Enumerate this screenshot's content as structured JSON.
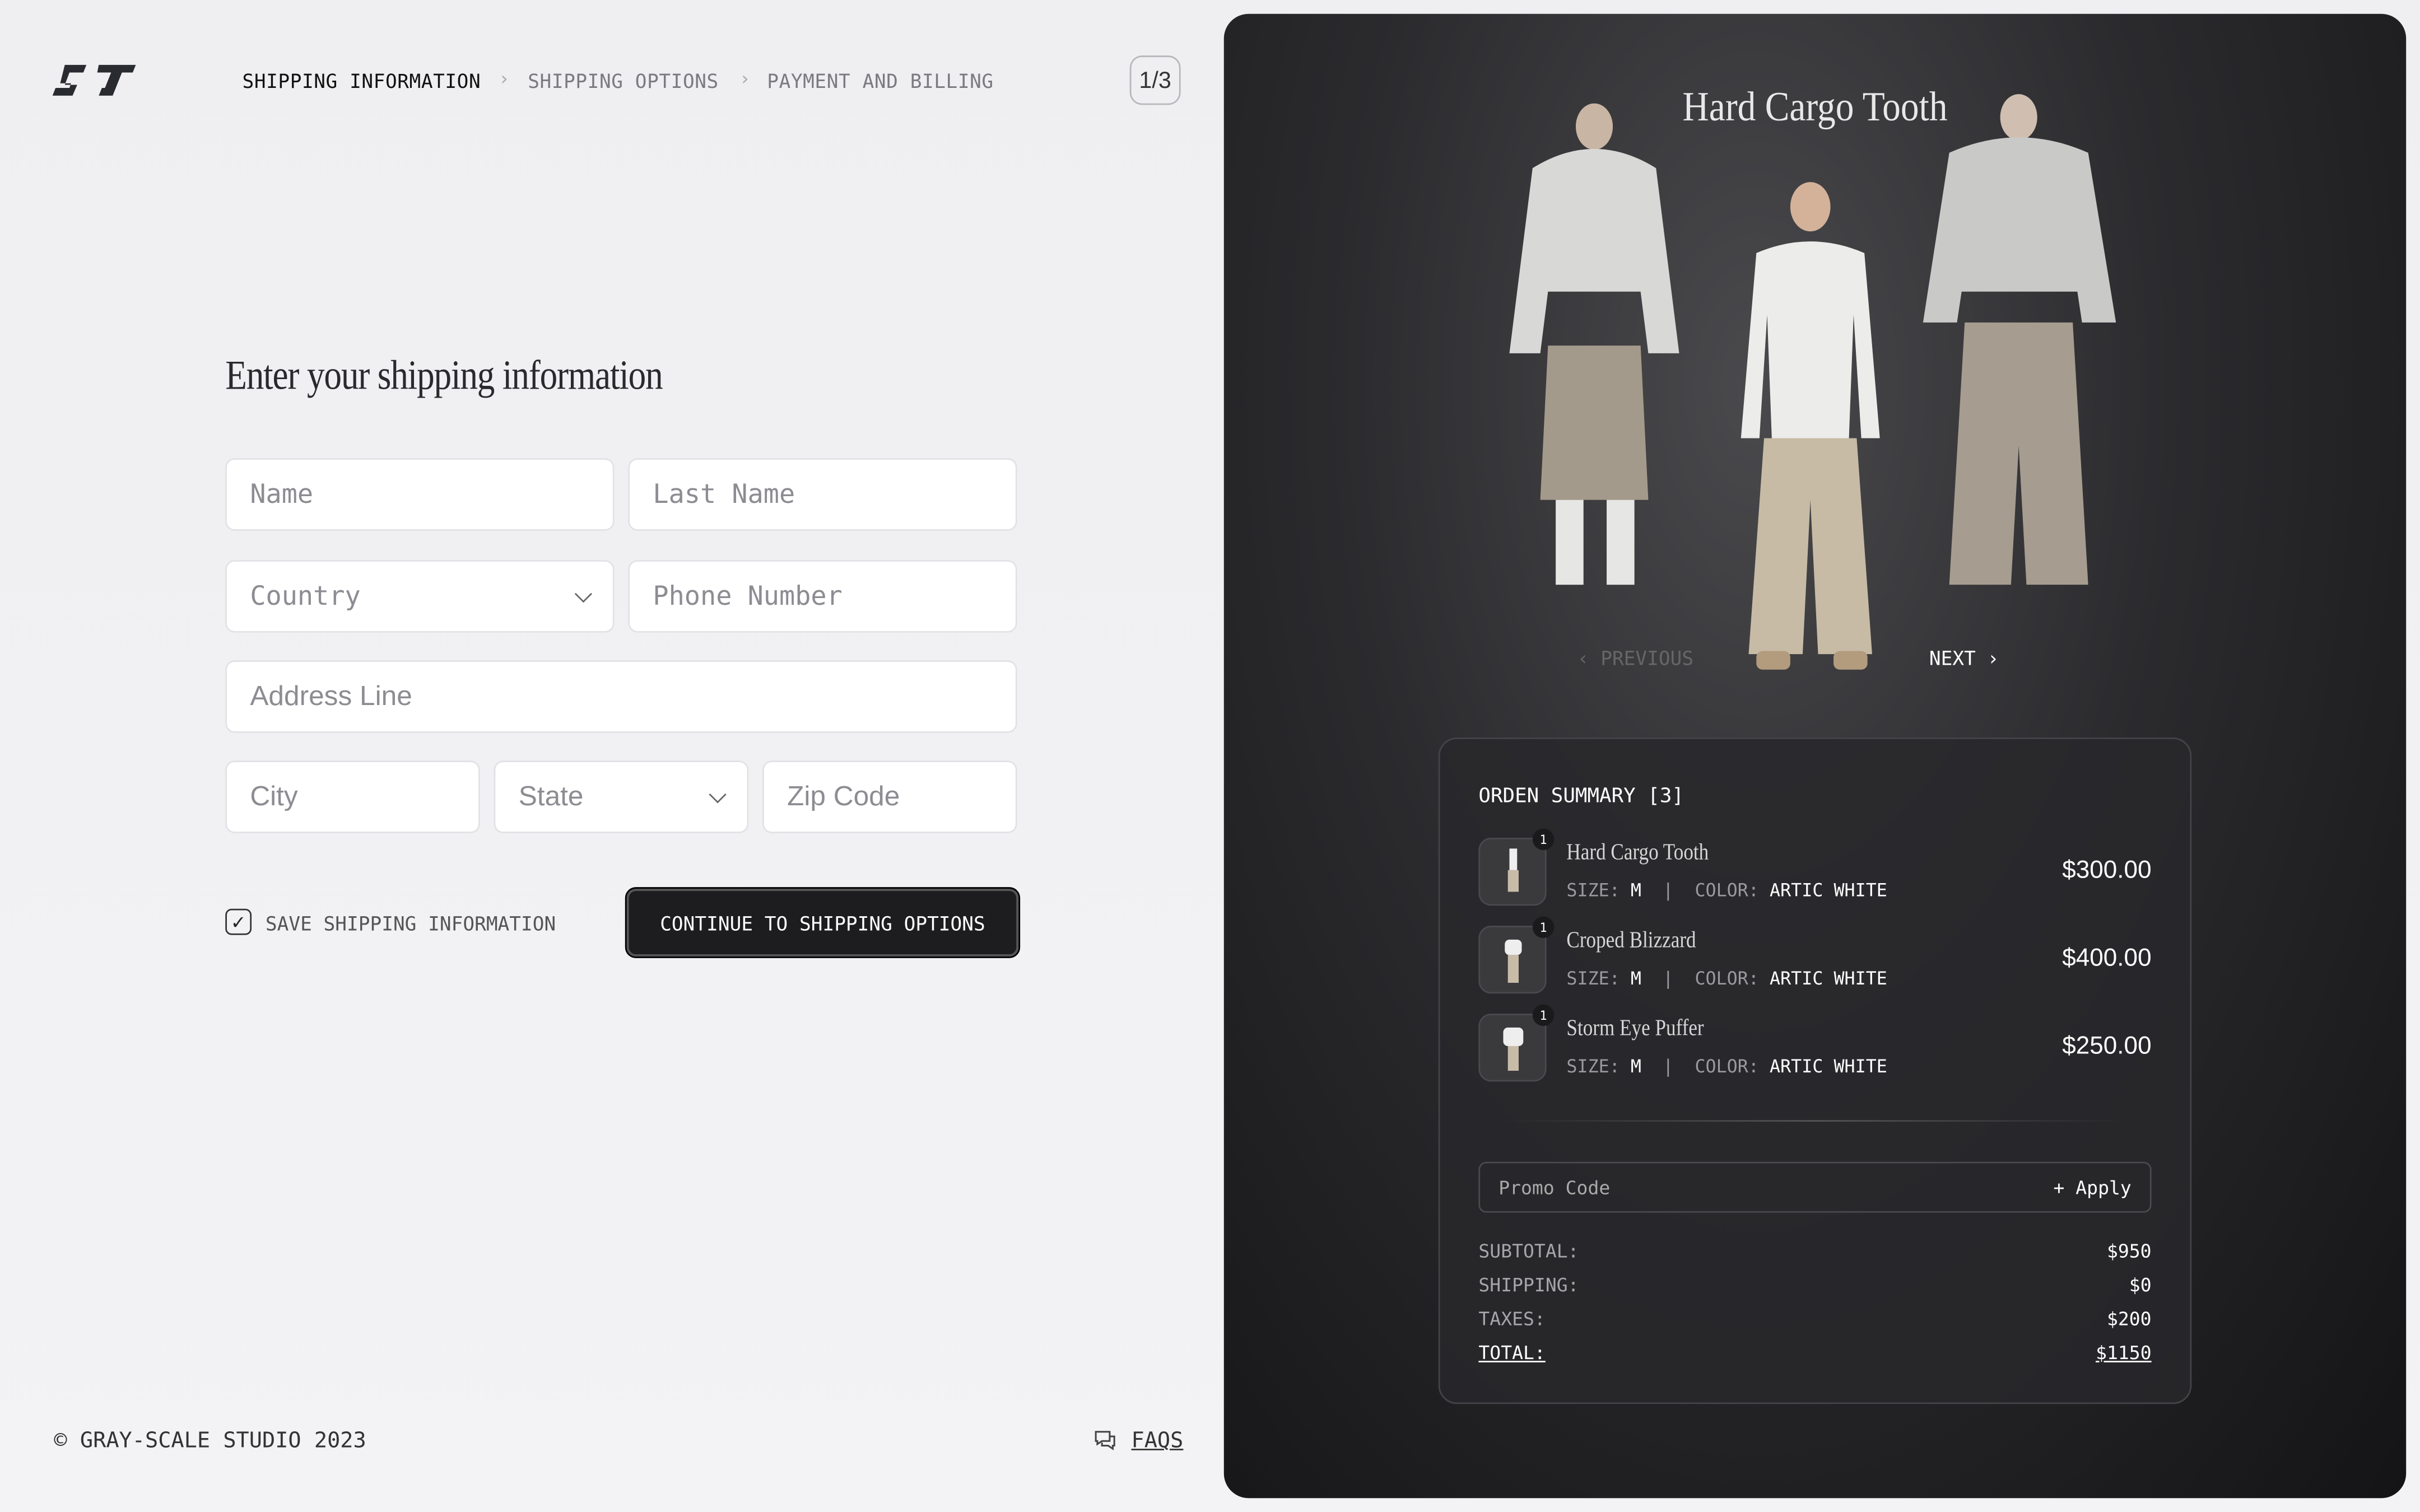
{
  "brand": {
    "logo": "GS monogram"
  },
  "breadcrumb": [
    {
      "label": "SHIPPING INFORMATION",
      "active": true
    },
    {
      "label": "SHIPPING OPTIONS",
      "active": false
    },
    {
      "label": "PAYMENT AND BILLING",
      "active": false
    }
  ],
  "step_indicator": "1/3",
  "form": {
    "title": "Enter your shipping information",
    "name_placeholder": "Name",
    "last_name_placeholder": "Last Name",
    "country_placeholder": "Country",
    "phone_placeholder": "Phone Number",
    "address_placeholder": "Address Line",
    "city_placeholder": "City",
    "state_placeholder": "State",
    "zip_placeholder": "Zip Code",
    "save_label": "SAVE SHIPPING INFORMATION",
    "save_checked": true,
    "continue_label": "CONTINUE TO SHIPPING OPTIONS"
  },
  "footer": {
    "copyright": "© GRAY-SCALE STUDIO 2023",
    "faqs": "FAQS"
  },
  "product_showcase": {
    "title": "Hard Cargo Tooth",
    "previous": "PREVIOUS",
    "next": "NEXT"
  },
  "order_summary": {
    "title": "ORDEN SUMMARY [3]",
    "size_label": "SIZE:",
    "color_label": "COLOR:",
    "items": [
      {
        "qty": "1",
        "name": "Hard Cargo Tooth",
        "size": "M",
        "color": "ARTIC WHITE",
        "price": "$300.00"
      },
      {
        "qty": "1",
        "name": "Croped Blizzard",
        "size": "M",
        "color": "ARTIC WHITE",
        "price": "$400.00"
      },
      {
        "qty": "1",
        "name": "Storm Eye Puffer",
        "size": "M",
        "color": "ARTIC WHITE",
        "price": "$250.00"
      }
    ],
    "promo_placeholder": "Promo Code",
    "apply_label": "+ Apply",
    "subtotal_label": "SUBTOTAL:",
    "subtotal": "$950",
    "shipping_label": "SHIPPING:",
    "shipping": "$0",
    "taxes_label": "TAXES:",
    "taxes": "$200",
    "total_label": "TOTAL:",
    "total": "$1150"
  }
}
